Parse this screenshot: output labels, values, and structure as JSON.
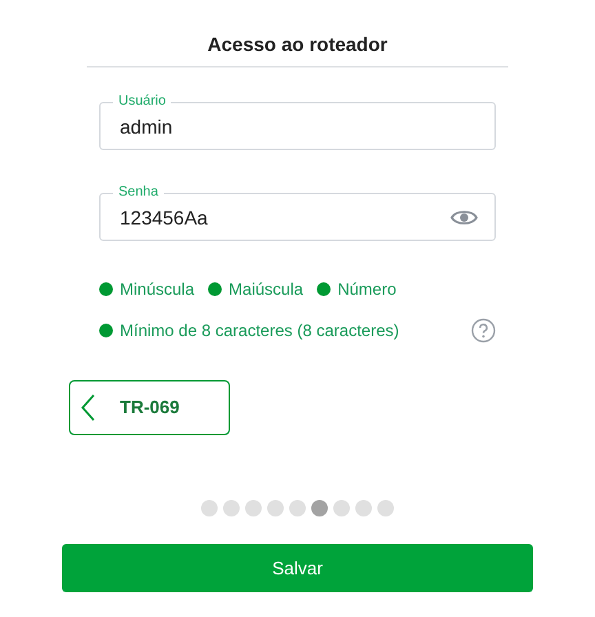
{
  "title": "Acesso ao roteador",
  "username": {
    "label": "Usuário",
    "value": "admin"
  },
  "password": {
    "label": "Senha",
    "value": "123456Aa"
  },
  "requirements": [
    {
      "text": "Minúscula",
      "met": true
    },
    {
      "text": "Maiúscula",
      "met": true
    },
    {
      "text": "Número",
      "met": true
    },
    {
      "text": "Mínimo de 8 caracteres (8 caracteres)",
      "met": true
    }
  ],
  "back_button": {
    "label": "TR-069"
  },
  "pages": [
    {
      "selected": false
    },
    {
      "selected": false
    },
    {
      "selected": false
    },
    {
      "selected": false
    },
    {
      "selected": false
    },
    {
      "selected": true
    },
    {
      "selected": false
    },
    {
      "selected": false
    },
    {
      "selected": false
    }
  ],
  "save_button": {
    "label": "Salvar"
  }
}
